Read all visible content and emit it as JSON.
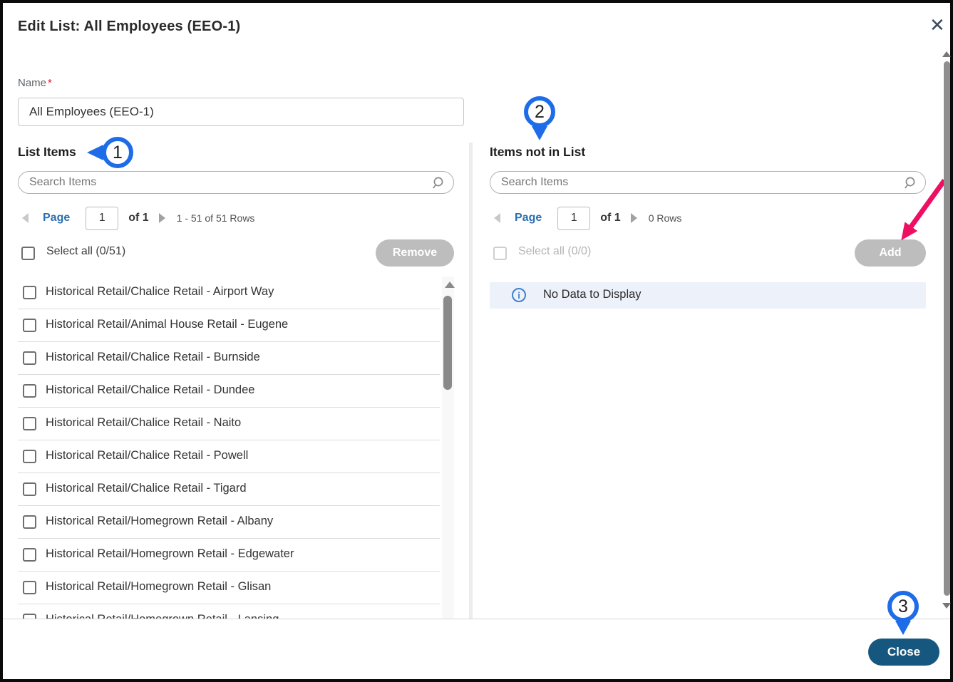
{
  "dialog": {
    "title": "Edit List: All Employees (EEO-1)",
    "close_icon": "✕"
  },
  "form": {
    "name_label": "Name",
    "required_marker": "*",
    "name_value": "All Employees (EEO-1)"
  },
  "left_panel": {
    "heading": "List Items",
    "search_placeholder": "Search Items",
    "pagination": {
      "page_label": "Page",
      "page_value": "1",
      "of_label": "of 1",
      "rows_label": "1 - 51 of 51 Rows"
    },
    "select_all_label": "Select all (0/51)",
    "remove_button_label": "Remove",
    "items": [
      "Historical Retail/Chalice Retail - Airport Way",
      "Historical Retail/Animal House Retail - Eugene",
      "Historical Retail/Chalice Retail - Burnside",
      "Historical Retail/Chalice Retail - Dundee",
      "Historical Retail/Chalice Retail - Naito",
      "Historical Retail/Chalice Retail - Powell",
      "Historical Retail/Chalice Retail - Tigard",
      "Historical Retail/Homegrown Retail - Albany",
      "Historical Retail/Homegrown Retail - Edgewater",
      "Historical Retail/Homegrown Retail - Glisan",
      "Historical Retail/Homegrown Retail - Lansing"
    ]
  },
  "right_panel": {
    "heading": "Items not in List",
    "search_placeholder": "Search Items",
    "pagination": {
      "page_label": "Page",
      "page_value": "1",
      "of_label": "of 1",
      "rows_label": "0 Rows"
    },
    "select_all_label": "Select all (0/0)",
    "add_button_label": "Add",
    "no_data_message": "No Data to Display",
    "info_icon_glyph": "i"
  },
  "footer": {
    "close_button_label": "Close"
  },
  "annotations": {
    "step1": "1",
    "step2": "2",
    "step3": "3"
  },
  "colors": {
    "annotation_blue": "#1e6ce8",
    "arrow_pink": "#ee0f63",
    "close_button_blue": "#15577e",
    "disabled_button_gray": "#bdbdbd",
    "info_banner_bg": "#edf1fa",
    "link_blue": "#2c6fae",
    "required_red": "#e8112d"
  }
}
